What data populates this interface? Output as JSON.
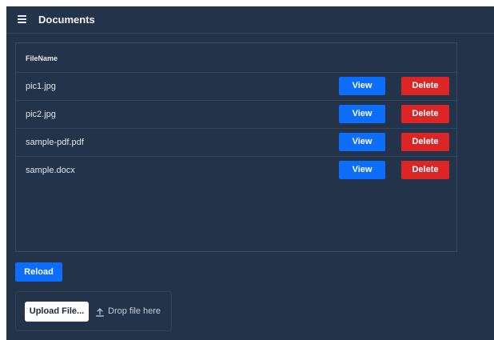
{
  "header": {
    "title": "Documents",
    "menu_icon": "hamburger-menu-icon"
  },
  "table": {
    "columns": [
      "FileName"
    ],
    "rows": [
      {
        "name": "pic1.jpg",
        "view_label": "View",
        "delete_label": "Delete"
      },
      {
        "name": "pic2.jpg",
        "view_label": "View",
        "delete_label": "Delete"
      },
      {
        "name": "sample-pdf.pdf",
        "view_label": "View",
        "delete_label": "Delete"
      },
      {
        "name": "sample.docx",
        "view_label": "View",
        "delete_label": "Delete"
      }
    ]
  },
  "actions": {
    "reload_label": "Reload"
  },
  "upload": {
    "button_label": "Upload File...",
    "drop_text": "Drop file here",
    "icon": "upload-icon"
  },
  "colors": {
    "background": "#22334a",
    "primary": "#0d6efd",
    "danger": "#dc2626"
  }
}
